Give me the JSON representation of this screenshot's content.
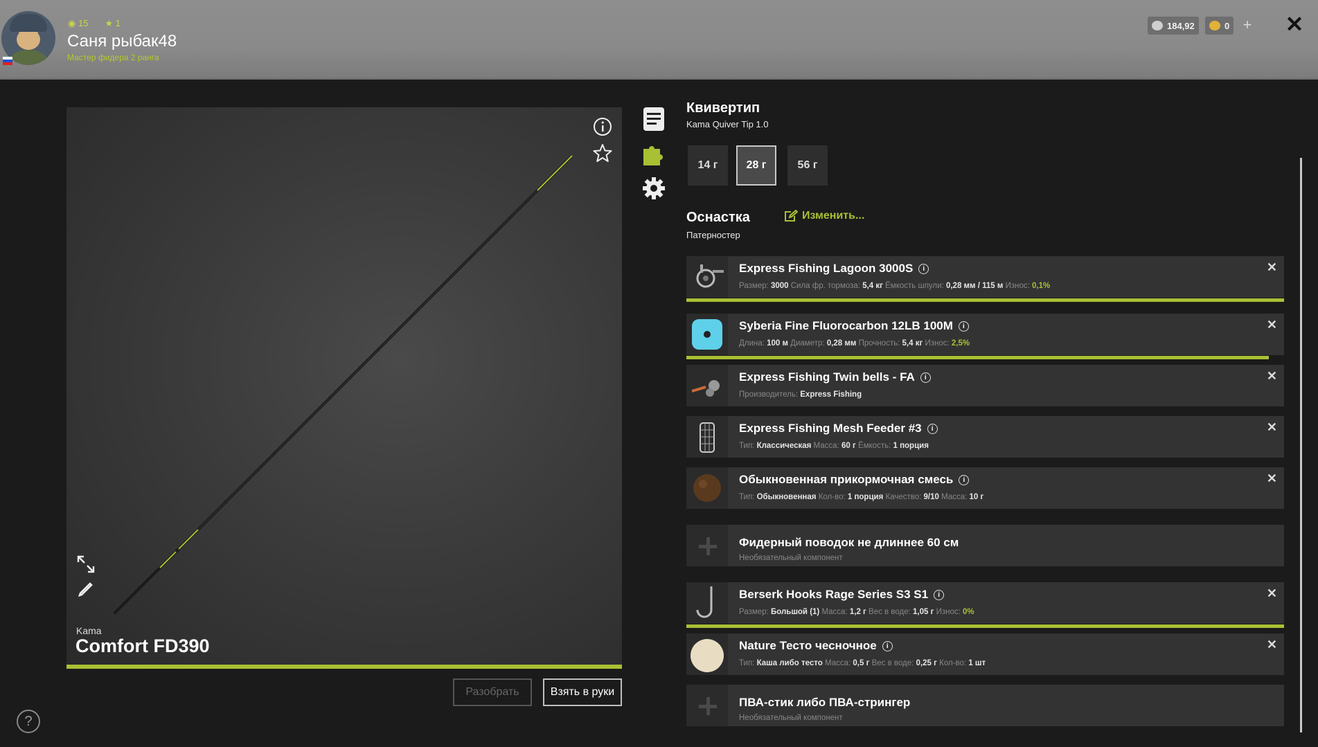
{
  "header": {
    "stat_level": "15",
    "stat_stars": "1",
    "player_name": "Саня рыбак48",
    "player_rank": "Мастер фидера 2 ранга",
    "silver": "184,92",
    "gold": "0",
    "colors": {
      "accent": "#a8c034",
      "topbar": "#8b8b8b"
    }
  },
  "rod": {
    "brand": "Kama",
    "model": "Comfort FD390",
    "btn_disassemble": "Разобрать",
    "btn_take": "Взять в руки"
  },
  "quivertip": {
    "title": "Квивертип",
    "subtitle": "Kama Quiver Tip 1.0",
    "weights": [
      "14 г",
      "28 г",
      "56 г"
    ],
    "selected": "28 г"
  },
  "rig": {
    "title": "Оснастка",
    "subtitle": "Патерностер",
    "edit_label": "Изменить..."
  },
  "items": [
    {
      "name": "Express Fishing Lagoon 3000S",
      "props": [
        [
          "Размер:",
          "3000"
        ],
        [
          "Сила фр. тормоза:",
          "5,4 кг"
        ],
        [
          "Ёмкость шпули:",
          "0,28 мм / 115 м"
        ],
        [
          "Износ:",
          "0,1%"
        ]
      ],
      "durability": 1.0,
      "icon": "reel-icon"
    },
    {
      "name": "Syberia Fine Fluorocarbon 12LB 100M",
      "props": [
        [
          "Длина:",
          "100 м"
        ],
        [
          "Диаметр:",
          "0,28 мм"
        ],
        [
          "Прочность:",
          "5,4 кг"
        ],
        [
          "Износ:",
          "2,5%"
        ]
      ],
      "durability": 0.975,
      "icon": "line-spool-icon"
    },
    {
      "name": "Express Fishing Twin bells - FA",
      "props": [
        [
          "Производитель:",
          "Express Fishing"
        ]
      ],
      "icon": "bells-icon"
    },
    {
      "name": "Express Fishing Mesh Feeder #3",
      "props": [
        [
          "Тип:",
          "Классическая"
        ],
        [
          "Масса:",
          "60 г"
        ],
        [
          "Ёмкость:",
          "1 порция"
        ]
      ],
      "icon": "feeder-icon"
    },
    {
      "name": "Обыкновенная прикормочная смесь",
      "props": [
        [
          "Тип:",
          "Обыкновенная"
        ],
        [
          "Кол-во:",
          "1 порция"
        ],
        [
          "Качество:",
          "9/10"
        ],
        [
          "Масса:",
          "10 г"
        ]
      ],
      "icon": "groundbait-icon"
    },
    {
      "name": "Фидерный поводок не длиннее 60 см",
      "empty": true,
      "note": "Необязательный компонент"
    },
    {
      "name": "Berserk Hooks Rage Series S3 S1",
      "props": [
        [
          "Размер:",
          "Большой (1)"
        ],
        [
          "Масса:",
          "1,2 г"
        ],
        [
          "Вес в воде:",
          "1,05 г"
        ],
        [
          "Износ:",
          "0%"
        ]
      ],
      "durability": 1.0,
      "icon": "hook-icon"
    },
    {
      "name": "Nature Тесто чесночное",
      "props": [
        [
          "Тип:",
          "Каша либо тесто"
        ],
        [
          "Масса:",
          "0,5 г"
        ],
        [
          "Вес в воде:",
          "0,25 г"
        ],
        [
          "Кол-во:",
          "1 шт"
        ]
      ],
      "icon": "dough-icon"
    },
    {
      "name": "ПВА-стик либо ПВА-стрингер",
      "empty": true,
      "note": "Необязательный компонент"
    }
  ]
}
